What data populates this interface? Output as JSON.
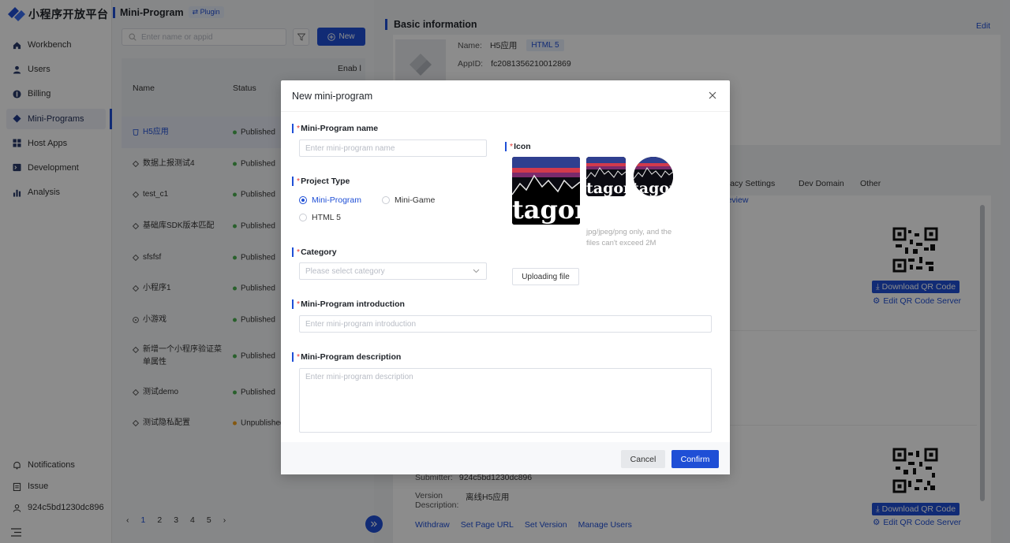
{
  "brand": {
    "name": "小程序开放平台"
  },
  "sidebar": {
    "items": [
      {
        "label": "Workbench",
        "icon": "home-icon"
      },
      {
        "label": "Users",
        "icon": "user-icon"
      },
      {
        "label": "Billing",
        "icon": "billing-icon"
      },
      {
        "label": "Mini-Programs",
        "icon": "diamond-icon",
        "active": true
      },
      {
        "label": "Host Apps",
        "icon": "grid-icon"
      },
      {
        "label": "Development",
        "icon": "terminal-icon"
      },
      {
        "label": "Analysis",
        "icon": "bar-chart-icon"
      }
    ],
    "bottom": [
      {
        "label": "Notifications",
        "icon": "bell-icon"
      },
      {
        "label": "Issue",
        "icon": "clipboard-icon"
      },
      {
        "label": "924c5bd1230dc896",
        "icon": "account-icon"
      }
    ]
  },
  "list": {
    "title": "Mini-Program",
    "plugin_label": "Plugin",
    "search_placeholder": "Enter name or appid",
    "new_label": "New",
    "columns": {
      "name": "Name",
      "status": "Status",
      "enabled": "Enab l"
    },
    "rows": [
      {
        "name": "H5应用",
        "status": "Published"
      },
      {
        "name": "数据上报测试4",
        "status": "Published"
      },
      {
        "name": "test_c1",
        "status": "Published"
      },
      {
        "name": "基础库SDK版本匹配",
        "status": "Published"
      },
      {
        "name": "sfsfsf",
        "status": "Published"
      },
      {
        "name": "小程序1",
        "status": "Published"
      },
      {
        "name": "小游戏",
        "status": "Published"
      },
      {
        "name": "新增一个小程序验证菜单属性",
        "status": "Published"
      },
      {
        "name": "测试demo",
        "status": "Published"
      },
      {
        "name": "测试隐私配置",
        "status": "Unpublished"
      }
    ],
    "pages": [
      "1",
      "2",
      "3",
      "4",
      "5"
    ]
  },
  "detail": {
    "title": "Basic information",
    "edit_label": "Edit",
    "name_key": "Name:",
    "name_value": "H5应用",
    "type_tag": "HTML 5",
    "appid_key": "AppID:",
    "appid_value": "fc2081356210012869",
    "tabs": [
      "rivacy Settings",
      "Dev Domain",
      "Other"
    ],
    "download_qr_label": "Download QR Code",
    "edit_qr_label": "Edit QR Code Server",
    "review_label": "Review",
    "submitter_key": "Submitter:",
    "submitter_value": "924c5bd1230dc896",
    "version_desc_key": "Version Description:",
    "version_desc_value": "离线H5应用",
    "bottom_actions": [
      "Withdraw",
      "Set Page URL",
      "Set Version",
      "Manage Users"
    ]
  },
  "modal": {
    "title": "New mini-program",
    "name_label": "Mini-Program name",
    "name_placeholder": "Enter mini-program name",
    "type_label": "Project Type",
    "type_options": [
      "Mini-Program",
      "Mini-Game",
      "HTML 5"
    ],
    "type_selected": "Mini-Program",
    "category_label": "Category",
    "category_placeholder": "Please select category",
    "intro_label": "Mini-Program introduction",
    "intro_placeholder": "Enter mini-program introduction",
    "desc_label": "Mini-Program description",
    "desc_placeholder": "Enter mini-program description",
    "icon_label": "Icon",
    "icon_word": "tagor",
    "icon_hint": "jpg/jpeg/png only, and the files can't exceed 2M",
    "upload_label": "Uploading file",
    "cancel_label": "Cancel",
    "confirm_label": "Confirm",
    "required_mark": "*"
  },
  "colors": {
    "accent": "#1f4fd6",
    "required": "#e53935",
    "published": "#4caf50",
    "unpublished": "#f0a020"
  }
}
